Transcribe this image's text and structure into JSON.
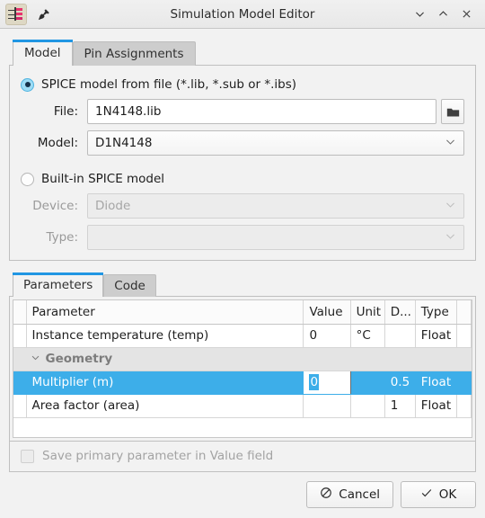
{
  "window": {
    "title": "Simulation Model Editor",
    "app_icon": "schematic-symbol-icon",
    "pin_icon": "pin-icon",
    "minimize_icon": "chevron-down-icon",
    "maximize_icon": "chevron-up-icon",
    "close_icon": "close-icon"
  },
  "tabs": [
    {
      "label": "Model",
      "active": true
    },
    {
      "label": "Pin Assignments",
      "active": false
    }
  ],
  "model_panel": {
    "file_radio": {
      "label": "SPICE model from file (*.lib, *.sub or *.ibs)",
      "selected": true
    },
    "file_field": {
      "label": "File:",
      "value": "1N4148.lib",
      "browse_icon": "folder-icon"
    },
    "model_field": {
      "label": "Model:",
      "value": "D1N4148",
      "chevron_icon": "chevron-down-icon"
    },
    "builtin_radio": {
      "label": "Built-in SPICE model",
      "selected": false
    },
    "device_field": {
      "label": "Device:",
      "value": "Diode",
      "disabled": true,
      "chevron_icon": "chevron-down-icon"
    },
    "type_field": {
      "label": "Type:",
      "value": "",
      "disabled": true,
      "chevron_icon": "chevron-down-icon"
    }
  },
  "param_tabs": [
    {
      "label": "Parameters",
      "active": true
    },
    {
      "label": "Code",
      "active": false
    }
  ],
  "table": {
    "headers": [
      "Parameter",
      "Value",
      "Unit",
      "D...",
      "Type",
      ""
    ],
    "rows": [
      {
        "kind": "normal",
        "parameter": "Instance temperature (temp)",
        "value": "0",
        "unit": "°C",
        "default": "",
        "type": "Float"
      },
      {
        "kind": "group",
        "parameter": "Geometry",
        "expand_icon": "chevron-down-icon",
        "value": "",
        "unit": "",
        "default": "",
        "type": ""
      },
      {
        "kind": "selected",
        "parameter": "Multiplier (m)",
        "value": "0",
        "editing": true,
        "unit": "",
        "default": "0.5",
        "type": "Float"
      },
      {
        "kind": "normal",
        "parameter": "Area factor (area)",
        "value": "",
        "unit": "",
        "default": "1",
        "type": "Float"
      }
    ]
  },
  "save_checkbox": {
    "label": "Save primary parameter in Value field",
    "checked": false,
    "disabled": true
  },
  "buttons": {
    "cancel": {
      "label": "Cancel",
      "icon": "cancel-circle-slash-icon"
    },
    "ok": {
      "label": "OK",
      "icon": "check-icon"
    }
  },
  "colors": {
    "accent": "#3daee9",
    "tab_accent": "#2196e3",
    "panel_bg": "#f2f2f2",
    "group_row_bg": "#e4e4e4"
  }
}
